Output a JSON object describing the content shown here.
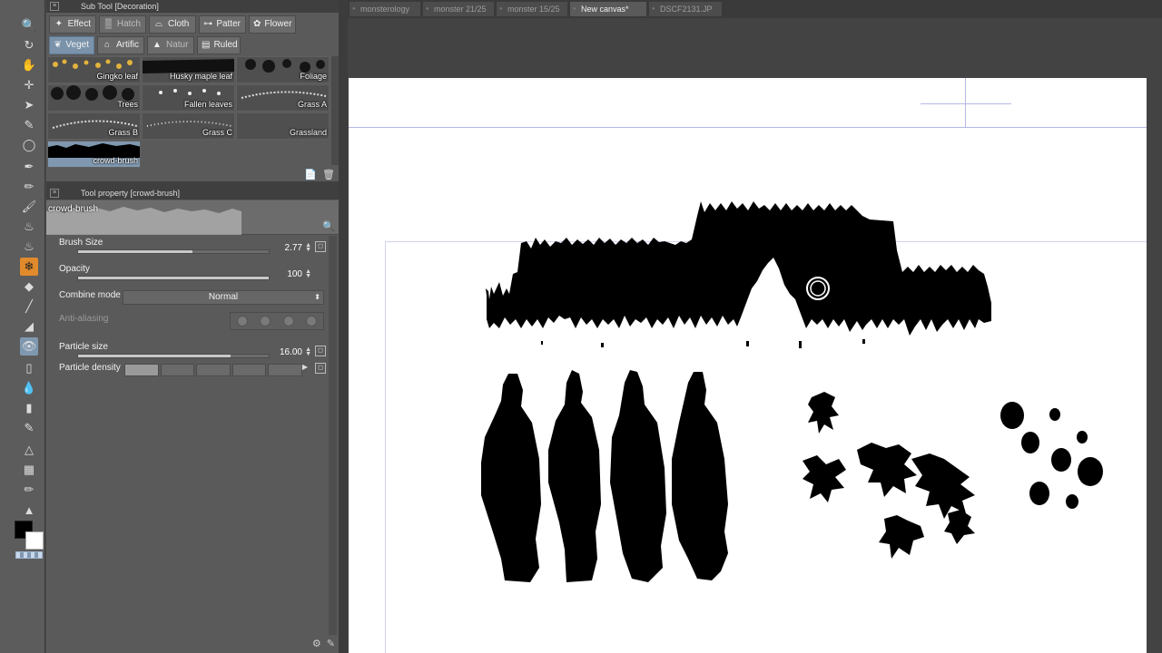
{
  "subtool_panel": {
    "title": "Sub Tool [Decoration]",
    "tabs": [
      {
        "label": "Effect",
        "icon": "sparkle-icon"
      },
      {
        "label": "Hatch",
        "icon": "hatch-icon"
      },
      {
        "label": "Cloth",
        "icon": "cloth-icon"
      },
      {
        "label": "Patter",
        "icon": "pattern-icon"
      },
      {
        "label": "Flower",
        "icon": "flower-icon"
      },
      {
        "label": "Veget",
        "icon": "leaf-icon"
      },
      {
        "label": "Artific",
        "icon": "building-icon"
      },
      {
        "label": "Natur",
        "icon": "mountain-icon"
      },
      {
        "label": "Ruled",
        "icon": "ruled-icon"
      }
    ],
    "brushes": [
      "Gingko leaf",
      "Husky maple leaf",
      "Foliage",
      "Trees",
      "Fallen leaves",
      "Grass A",
      "Grass B",
      "Grass C",
      "Grassland",
      "crowd-brush"
    ],
    "selected_brush": "crowd-brush"
  },
  "tool_property": {
    "title": "Tool property [crowd-brush]",
    "preview_name": "crowd-brush",
    "brush_size": {
      "label": "Brush Size",
      "value": "2.77",
      "fraction": 0.6
    },
    "opacity": {
      "label": "Opacity",
      "value": "100",
      "fraction": 1.0
    },
    "combine_mode": {
      "label": "Combine mode",
      "value": "Normal"
    },
    "anti_aliasing": {
      "label": "Anti-aliasing"
    },
    "particle_size": {
      "label": "Particle size",
      "value": "16.00",
      "fraction": 0.8
    },
    "particle_density": {
      "label": "Particle density",
      "level": 1,
      "max": 5
    }
  },
  "document_tabs": [
    {
      "label": "monsterology",
      "active": false
    },
    {
      "label": "monster 21/25",
      "active": false
    },
    {
      "label": "monster 15/25",
      "active": false
    },
    {
      "label": "New canvas*",
      "active": true
    },
    {
      "label": "DSCF2131.JP",
      "active": false
    }
  ],
  "colors": {
    "foreground": "#000000",
    "background": "#ffffff",
    "accent": "#7f98b0"
  }
}
